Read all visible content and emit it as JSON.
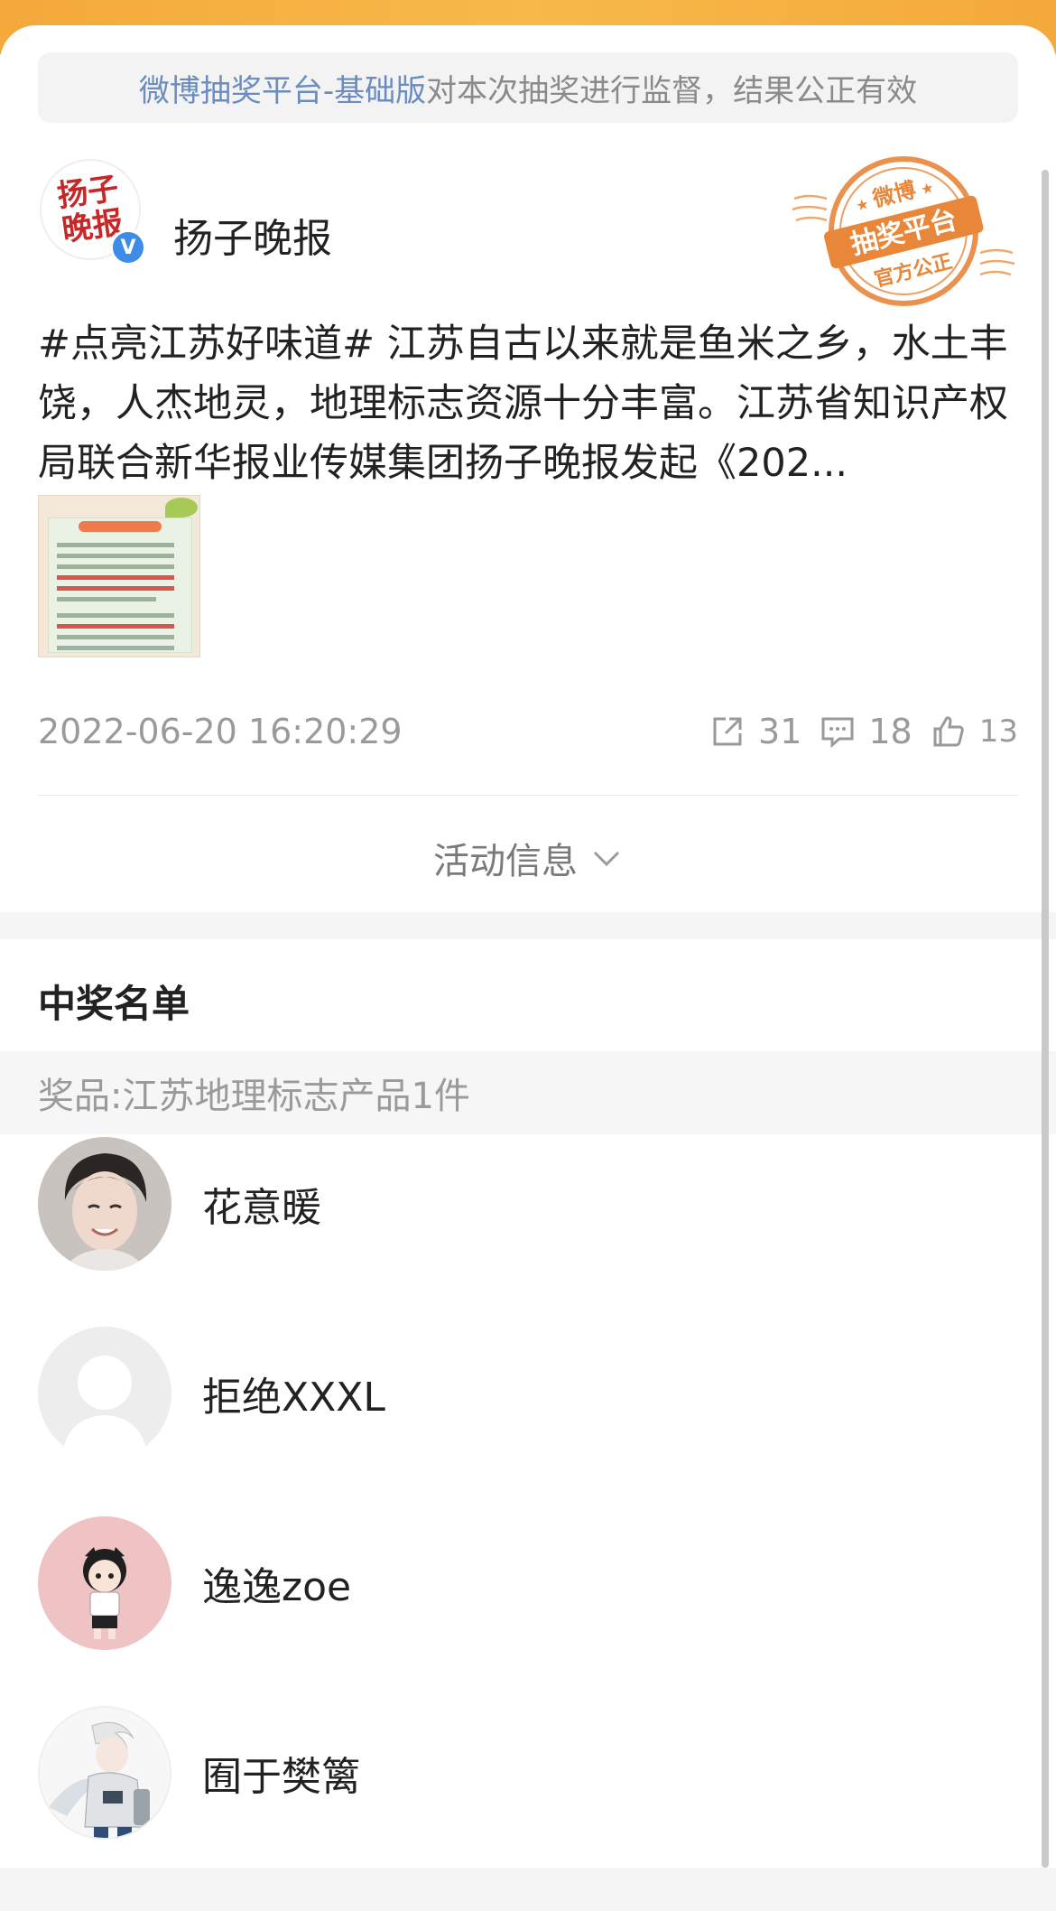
{
  "notice": {
    "link": "微博抽奖平台-基础版",
    "text": " 对本次抽奖进行监督，结果公正有效"
  },
  "account": {
    "name": "扬子晚报",
    "logo_text": "扬子晚报",
    "verified_mark": "V"
  },
  "stamp": {
    "top": "微博",
    "middle": "抽奖平台",
    "bottom": "官方公正"
  },
  "post": {
    "text": "#点亮江苏好味道# 江苏自古以来就是鱼米之乡，水土丰饶，人杰地灵，地理标志资源十分丰富。江苏省知识产权局联合新华报业传媒集团扬子晚报发起《202...",
    "timestamp": "2022-06-20 16:20:29",
    "reposts": "31",
    "comments": "18",
    "likes": "13"
  },
  "activity_info_label": "活动信息",
  "winners": {
    "title": "中奖名单",
    "prize": "奖品:江苏地理标志产品1件",
    "list": [
      {
        "name": "花意暖",
        "avatar": "man-portrait-avatar"
      },
      {
        "name": "拒绝XXXL",
        "avatar": "default-avatar"
      },
      {
        "name": "逸逸zoe",
        "avatar": "cartoon-girl-avatar"
      },
      {
        "name": "囿于樊篱",
        "avatar": "anime-character-avatar"
      }
    ]
  },
  "colors": {
    "top_bar": "#f4a93a",
    "link": "#6a8cbf",
    "stamp": "#e8863a",
    "verified": "#3d8ce8"
  }
}
